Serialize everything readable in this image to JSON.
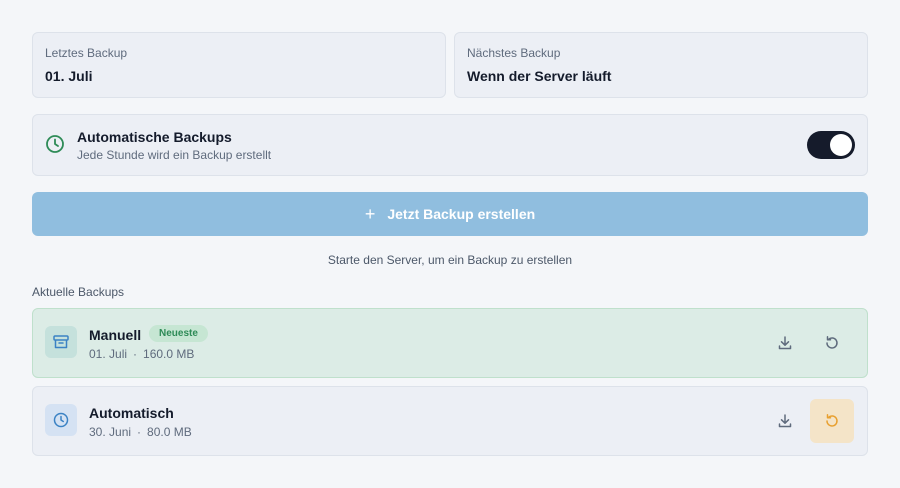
{
  "last_backup": {
    "label": "Letztes Backup",
    "value": "01. Juli"
  },
  "next_backup": {
    "label": "Nächstes Backup",
    "value": "Wenn der Server läuft"
  },
  "auto_backups": {
    "title": "Automatische Backups",
    "subtitle": "Jede Stunde wird ein Backup erstellt",
    "enabled": true,
    "icon": "clock-icon"
  },
  "create_button": {
    "label": "Jetzt Backup erstellen",
    "icon": "plus-icon"
  },
  "hint": "Starte den Server, um ein Backup zu erstellen",
  "section_title": "Aktuelle Backups",
  "backups": [
    {
      "title": "Manuell",
      "badge": "Neueste",
      "date": "01. Juli",
      "size": "160.0 MB",
      "icon": "archive-icon"
    },
    {
      "title": "Automatisch",
      "badge": "",
      "date": "30. Juni",
      "size": "80.0 MB",
      "icon": "clock-icon"
    }
  ],
  "separator": "·",
  "colors": {
    "accent_green": "#2e8b57",
    "button_blue": "#90bedf",
    "latest_row_bg": "#dcece6",
    "restore_highlight": "#f4e4c8",
    "restore_highlight_icon": "#e8a030",
    "toggle_on": "#151b2b"
  }
}
